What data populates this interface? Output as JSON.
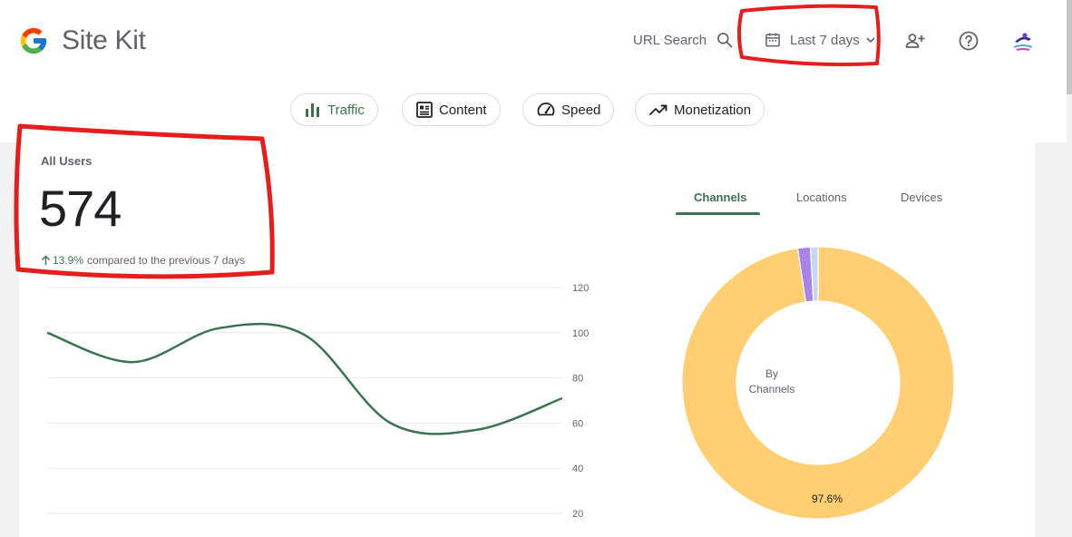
{
  "header": {
    "app_name": "Site Kit",
    "url_search_label": "URL Search",
    "date_range_label": "Last 7 days"
  },
  "nav_chips": [
    {
      "label": "Traffic",
      "active": true
    },
    {
      "label": "Content",
      "active": false
    },
    {
      "label": "Speed",
      "active": false
    },
    {
      "label": "Monetization",
      "active": false
    }
  ],
  "metric": {
    "title": "All Users",
    "value": "574",
    "change_pct": "13.9%",
    "change_text": "compared to the previous 7 days"
  },
  "tabs": [
    "Channels",
    "Locations",
    "Devices"
  ],
  "donut_center": {
    "line1": "By",
    "line2": "Channels"
  },
  "colors": {
    "accent": "#3c7251",
    "donut_main": "#fecf72",
    "donut_purple": "#a983e6",
    "donut_blue": "#c3d7f7",
    "annotation_red": "#e51d1d"
  },
  "chart_data": [
    {
      "type": "line",
      "title": "",
      "xlabel": "",
      "ylabel": "",
      "ylim": [
        20,
        120
      ],
      "y_ticks": [
        "120",
        "100",
        "80",
        "60",
        "40",
        "20"
      ],
      "x": [
        0,
        1,
        2,
        3,
        4,
        5,
        6
      ],
      "series": [
        {
          "values": [
            100,
            87,
            102,
            99,
            60,
            57,
            71
          ]
        }
      ],
      "grid": true
    },
    {
      "type": "pie",
      "title": "",
      "categories": [
        "",
        "",
        ""
      ],
      "values": [
        97.6,
        1.5,
        0.9
      ],
      "data_labels": [
        "97.6%"
      ],
      "colors": [
        "#fecf72",
        "#a983e6",
        "#c3d7f7"
      ]
    }
  ]
}
